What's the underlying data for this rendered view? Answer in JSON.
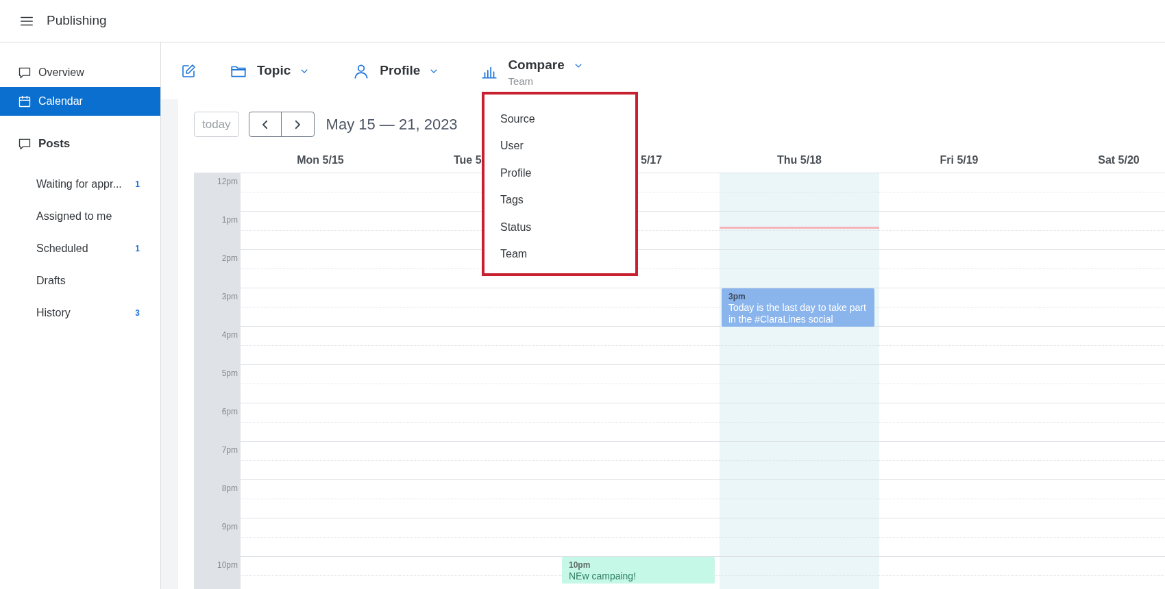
{
  "app": {
    "title": "Publishing"
  },
  "sidebar": {
    "nav": [
      {
        "label": "Overview",
        "selected": false
      },
      {
        "label": "Calendar",
        "selected": true
      }
    ],
    "posts": {
      "title": "Posts",
      "items": [
        {
          "label": "Waiting for appr...",
          "count": "1"
        },
        {
          "label": "Assigned to me"
        },
        {
          "label": "Scheduled",
          "count": "1"
        },
        {
          "label": "Drafts"
        },
        {
          "label": "History",
          "count": "3"
        }
      ]
    }
  },
  "toolbar": {
    "filters": [
      {
        "label": "Topic"
      },
      {
        "label": "Profile"
      },
      {
        "label": "Compare",
        "value": "Team",
        "expanded": true
      }
    ]
  },
  "compare_menu": {
    "options": [
      "Source",
      "User",
      "Profile",
      "Tags",
      "Status",
      "Team"
    ]
  },
  "calendar": {
    "today_button": "today",
    "range": "May 15 — 21, 2023",
    "hours": [
      "12pm",
      "1pm",
      "2pm",
      "3pm",
      "4pm",
      "5pm",
      "6pm",
      "7pm",
      "8pm",
      "9pm",
      "10pm"
    ],
    "days": [
      {
        "label": "Mon 5/15",
        "today": false
      },
      {
        "label": "Tue 5",
        "today": false
      },
      {
        "label": "5/17",
        "today": false,
        "events": [
          {
            "time": "10pm",
            "text": "NEw campaing!",
            "color": "#c6f8e8"
          }
        ]
      },
      {
        "label": "Thu 5/18",
        "today": true,
        "events": [
          {
            "time": "3pm",
            "text": "Today is the last day to take part in the #ClaraLines social",
            "color": "#8ab4ec"
          }
        ]
      },
      {
        "label": "Fri 5/19",
        "today": false
      },
      {
        "label": "Sat 5/20",
        "today": false
      }
    ]
  }
}
